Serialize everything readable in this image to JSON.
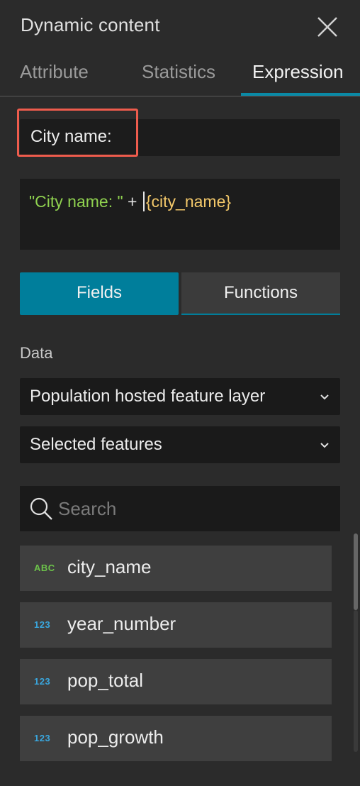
{
  "panel": {
    "title": "Dynamic content"
  },
  "tabs": [
    {
      "label": "Attribute"
    },
    {
      "label": "Statistics"
    },
    {
      "label": "Expression",
      "active": true
    }
  ],
  "preview": {
    "text": "City name:"
  },
  "editor": {
    "string_part": "\"City name: \"",
    "operator": " + ",
    "field_part": "{city_name}"
  },
  "segmented": {
    "fields_label": "Fields",
    "functions_label": "Functions",
    "selected": "Fields"
  },
  "data_section": {
    "label": "Data",
    "layer_select": "Population hosted feature layer",
    "scope_select": "Selected features"
  },
  "search": {
    "placeholder": "Search",
    "value": ""
  },
  "fields": [
    {
      "type": "ABC",
      "name": "city_name"
    },
    {
      "type": "123",
      "name": "year_number"
    },
    {
      "type": "123",
      "name": "pop_total"
    },
    {
      "type": "123",
      "name": "pop_growth"
    }
  ],
  "colors": {
    "accent": "#007e9b",
    "highlight_box": "#ee5c4d",
    "string_token": "#8fd14f",
    "field_token": "#f3c86a",
    "text_type": "#6cc24a",
    "number_type": "#3aa6dd"
  },
  "icons": [
    "close-icon",
    "chevron-down-icon",
    "search-icon"
  ]
}
